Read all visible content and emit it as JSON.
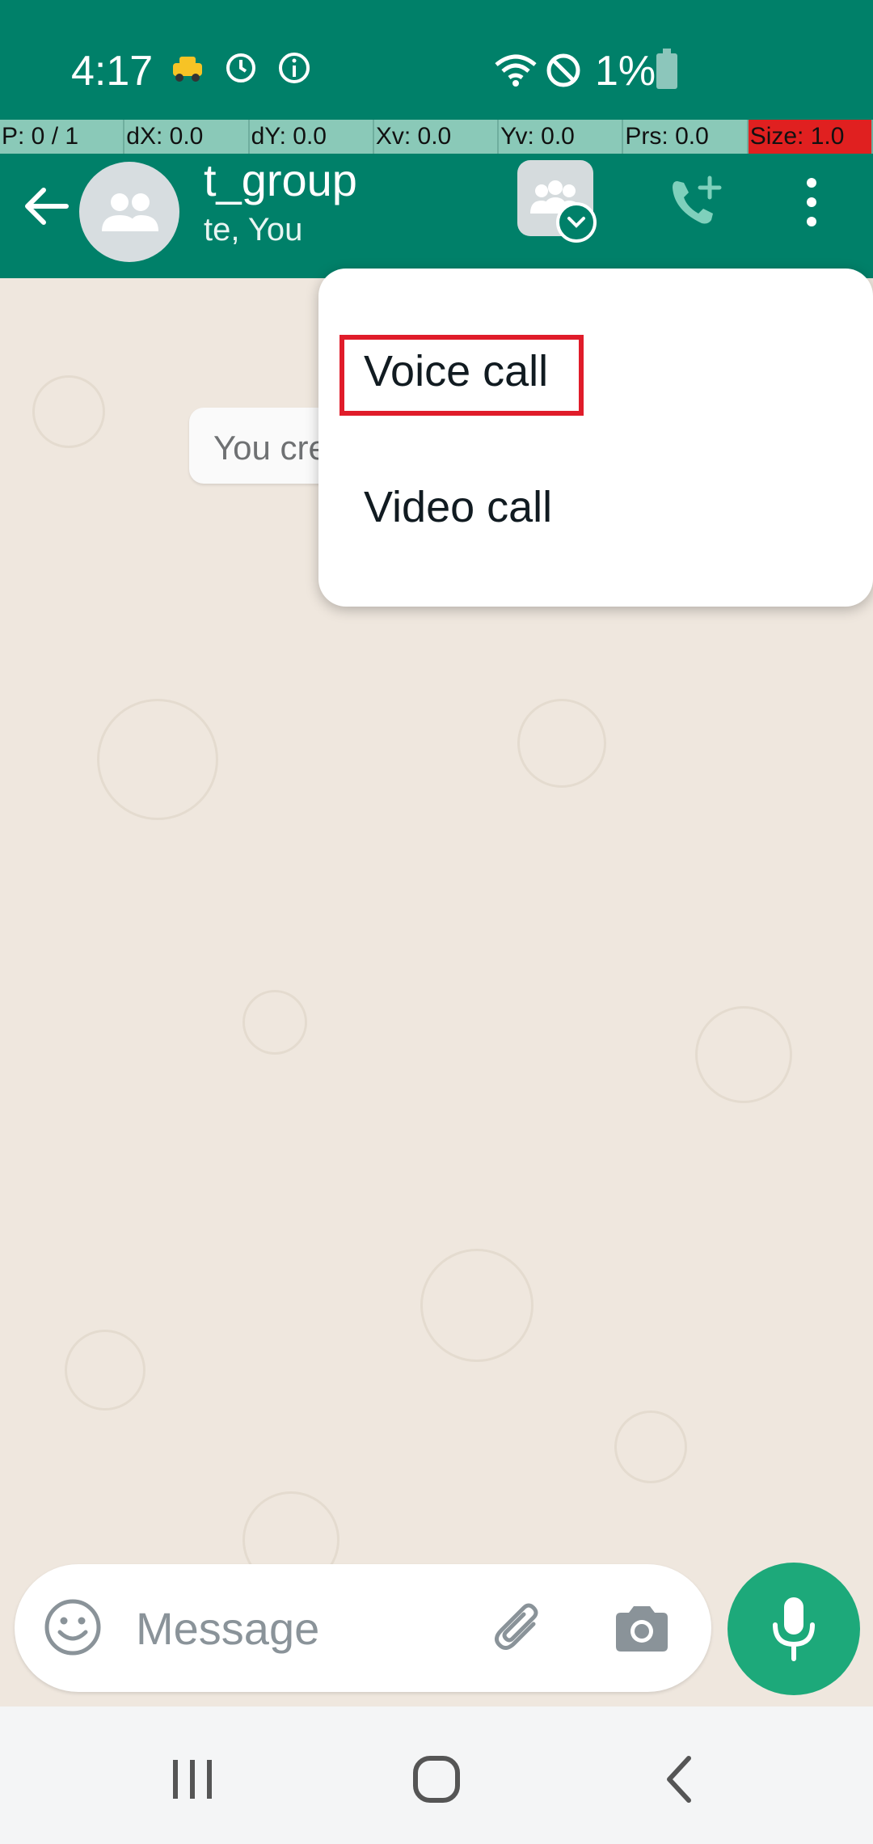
{
  "status_bar": {
    "time": "4:17",
    "battery_text": "1%",
    "icons": [
      "taxi-icon",
      "refresh-clock-icon",
      "info-icon",
      "wifi-icon",
      "do-not-disturb-icon",
      "battery-icon"
    ]
  },
  "debug": {
    "p": "P: 0 / 1",
    "dx": "dX: 0.0",
    "dy": "dY: 0.0",
    "xv": "Xv: 0.0",
    "yv": "Yv: 0.0",
    "prs": "Prs: 0.0",
    "size": "Size: 1.0"
  },
  "header": {
    "title": "t_group",
    "subtitle": "te, You"
  },
  "chat": {
    "system_message": "You cre"
  },
  "menu": {
    "items": [
      {
        "label": "Voice call"
      },
      {
        "label": "Video call"
      }
    ]
  },
  "composer": {
    "placeholder": "Message"
  },
  "colors": {
    "brand": "#008069",
    "mic": "#1da97a",
    "chat_bg": "#efe7de",
    "highlight": "#e01c2a"
  }
}
